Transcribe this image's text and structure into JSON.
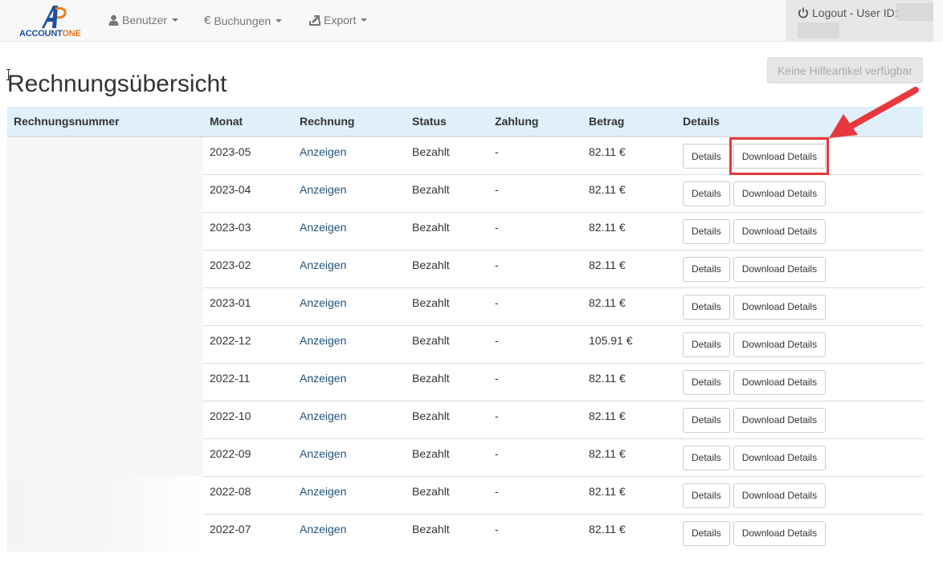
{
  "brand": {
    "logo_letter": "A",
    "name_part1": "ACCOUNT",
    "name_part2": "ONE"
  },
  "nav": {
    "items": [
      {
        "label": "Benutzer",
        "icon": "user-icon"
      },
      {
        "label": "Buchungen",
        "icon": "euro-icon"
      },
      {
        "label": "Export",
        "icon": "export-icon"
      }
    ],
    "user": {
      "label": "Logout - User ID:",
      "icon": "power-icon"
    }
  },
  "page": {
    "title": "Rechnungsübersicht",
    "help_button": "Keine Hilfeartikel verfügbar"
  },
  "table": {
    "headers": [
      "Rechnungsnummer",
      "Monat",
      "Rechnung",
      "Status",
      "Zahlung",
      "Betrag",
      "Details"
    ],
    "rows": [
      {
        "month": "2023-05",
        "invoice": "Anzeigen",
        "status": "Bezahlt",
        "payment": "-",
        "amount": "82.11 €",
        "details": "Details",
        "download": "Download Details"
      },
      {
        "month": "2023-04",
        "invoice": "Anzeigen",
        "status": "Bezahlt",
        "payment": "-",
        "amount": "82.11 €",
        "details": "Details",
        "download": "Download Details"
      },
      {
        "month": "2023-03",
        "invoice": "Anzeigen",
        "status": "Bezahlt",
        "payment": "-",
        "amount": "82.11 €",
        "details": "Details",
        "download": "Download Details"
      },
      {
        "month": "2023-02",
        "invoice": "Anzeigen",
        "status": "Bezahlt",
        "payment": "-",
        "amount": "82.11 €",
        "details": "Details",
        "download": "Download Details"
      },
      {
        "month": "2023-01",
        "invoice": "Anzeigen",
        "status": "Bezahlt",
        "payment": "-",
        "amount": "82.11 €",
        "details": "Details",
        "download": "Download Details"
      },
      {
        "month": "2022-12",
        "invoice": "Anzeigen",
        "status": "Bezahlt",
        "payment": "-",
        "amount": "105.91 €",
        "details": "Details",
        "download": "Download Details"
      },
      {
        "month": "2022-11",
        "invoice": "Anzeigen",
        "status": "Bezahlt",
        "payment": "-",
        "amount": "82.11 €",
        "details": "Details",
        "download": "Download Details"
      },
      {
        "month": "2022-10",
        "invoice": "Anzeigen",
        "status": "Bezahlt",
        "payment": "-",
        "amount": "82.11 €",
        "details": "Details",
        "download": "Download Details"
      },
      {
        "month": "2022-09",
        "invoice": "Anzeigen",
        "status": "Bezahlt",
        "payment": "-",
        "amount": "82.11 €",
        "details": "Details",
        "download": "Download Details"
      },
      {
        "month": "2022-08",
        "invoice": "Anzeigen",
        "status": "Bezahlt",
        "payment": "-",
        "amount": "82.11 €",
        "details": "Details",
        "download": "Download Details"
      },
      {
        "month": "2022-07",
        "invoice": "Anzeigen",
        "status": "Bezahlt",
        "payment": "-",
        "amount": "82.11 €",
        "details": "Details",
        "download": "Download Details"
      }
    ]
  },
  "colors": {
    "link": "#23527c",
    "header_bg": "#dff0fb",
    "annotation": "#e8383d",
    "logo_blue": "#1f4f9c",
    "logo_orange": "#f07a1a"
  }
}
